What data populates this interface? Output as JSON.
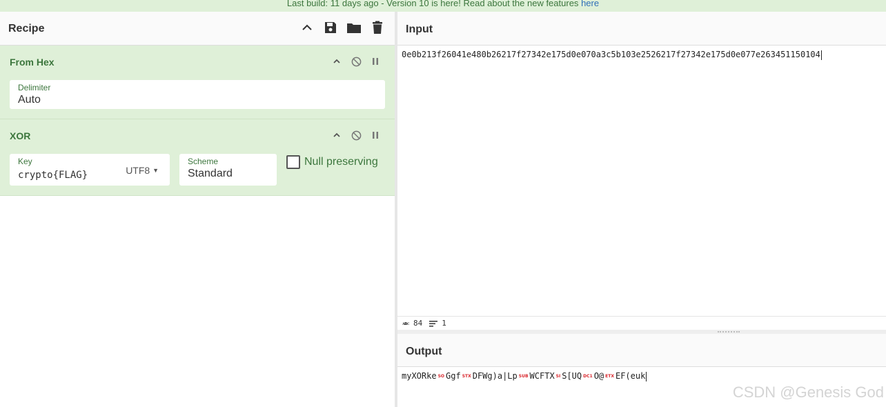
{
  "banner": {
    "text": "Last build: 11 days ago - Version 10 is here! Read about the new features",
    "link": "here"
  },
  "recipe": {
    "title": "Recipe",
    "tools": [
      "collapse-icon",
      "save-icon",
      "folder-icon",
      "trash-icon"
    ],
    "operations": [
      {
        "name": "From Hex",
        "fields": [
          {
            "label": "Delimiter",
            "value": "Auto"
          }
        ]
      },
      {
        "name": "XOR",
        "fields": [
          {
            "label": "Key",
            "value": "crypto{FLAG}",
            "encoding": "UTF8"
          },
          {
            "label": "Scheme",
            "value": "Standard"
          }
        ],
        "checkbox": {
          "label": "Null preserving",
          "checked": false
        }
      }
    ]
  },
  "input": {
    "title": "Input",
    "text": "0e0b213f26041e480b26217f27342e175d0e070a3c5b103e2526217f27342e175d0e077e263451150104",
    "length": "84",
    "lines": "1"
  },
  "output": {
    "title": "Output",
    "segments": [
      {
        "t": "text",
        "v": "myXORke"
      },
      {
        "t": "ctl",
        "v": "SO"
      },
      {
        "t": "text",
        "v": "Ggf"
      },
      {
        "t": "ctl",
        "v": "STX"
      },
      {
        "t": "text",
        "v": "DFWg)a|Lp"
      },
      {
        "t": "ctl",
        "v": "SUB"
      },
      {
        "t": "text",
        "v": "WCFTX"
      },
      {
        "t": "ctl",
        "v": "SI"
      },
      {
        "t": "text",
        "v": "S[UQ"
      },
      {
        "t": "ctl",
        "v": "DC1"
      },
      {
        "t": "text",
        "v": "O@"
      },
      {
        "t": "ctl",
        "v": "ETX"
      },
      {
        "t": "text",
        "v": "EF(euk"
      }
    ]
  },
  "watermark": "CSDN @Genesis God",
  "colors": {
    "accent_green": "#3c763d",
    "op_bg": "#dff0d8",
    "control_char": "#d9262c"
  }
}
